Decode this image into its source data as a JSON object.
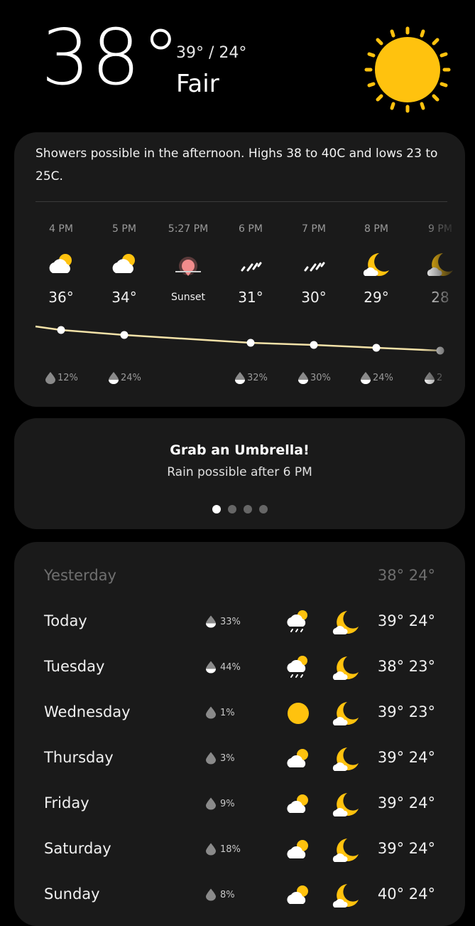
{
  "header": {
    "current_temp": "38°",
    "hi_lo": "39° / 24°",
    "condition": "Fair",
    "icon": "sun-icon"
  },
  "forecast": {
    "summary": "Showers possible in the afternoon. Highs 38 to 40C and lows 23 to 25C.",
    "hours": [
      {
        "time": "4 PM",
        "icon": "partly-cloudy-icon",
        "temp": "36°",
        "precip": "12%"
      },
      {
        "time": "5 PM",
        "icon": "partly-cloudy-icon",
        "temp": "34°",
        "precip": "24%"
      },
      {
        "time": "5:27 PM",
        "icon": "sunset-icon",
        "temp": "Sunset",
        "precip": ""
      },
      {
        "time": "6 PM",
        "icon": "rain-icon",
        "temp": "31°",
        "precip": "32%"
      },
      {
        "time": "7 PM",
        "icon": "rain-icon",
        "temp": "30°",
        "precip": "30%"
      },
      {
        "time": "8 PM",
        "icon": "moon-icon",
        "temp": "29°",
        "precip": "24%"
      },
      {
        "time": "9 PM",
        "icon": "moon-cloud-icon",
        "temp": "28",
        "precip": "2"
      }
    ]
  },
  "alert": {
    "title": "Grab an Umbrella!",
    "subtitle": "Rain possible after 6 PM",
    "pages": 4,
    "active_page": 0
  },
  "daily": [
    {
      "day": "Yesterday",
      "precip": "",
      "day_icon": "",
      "night_icon": "",
      "temps": "38° 24°"
    },
    {
      "day": "Today",
      "precip": "33%",
      "day_icon": "rain-cloud-icon",
      "night_icon": "moon-cloud-icon",
      "temps": "39° 24°"
    },
    {
      "day": "Tuesday",
      "precip": "44%",
      "day_icon": "rain-cloud-icon",
      "night_icon": "moon-cloud-icon",
      "temps": "38° 23°"
    },
    {
      "day": "Wednesday",
      "precip": "1%",
      "day_icon": "sun-icon",
      "night_icon": "moon-cloud-icon",
      "temps": "39° 23°"
    },
    {
      "day": "Thursday",
      "precip": "3%",
      "day_icon": "partly-cloudy-icon",
      "night_icon": "moon-cloud-icon",
      "temps": "39° 24°"
    },
    {
      "day": "Friday",
      "precip": "9%",
      "day_icon": "partly-cloudy-icon",
      "night_icon": "moon-cloud-icon",
      "temps": "39° 24°"
    },
    {
      "day": "Saturday",
      "precip": "18%",
      "day_icon": "partly-cloudy-icon",
      "night_icon": "moon-cloud-icon",
      "temps": "39° 24°"
    },
    {
      "day": "Sunday",
      "precip": "8%",
      "day_icon": "partly-cloudy-icon",
      "night_icon": "moon-cloud-icon",
      "temps": "40° 24°"
    }
  ],
  "colors": {
    "background": "#000000",
    "card": "#1a1a1a",
    "sun": "#FFC20E",
    "temp_line": "#F3E2A8"
  }
}
